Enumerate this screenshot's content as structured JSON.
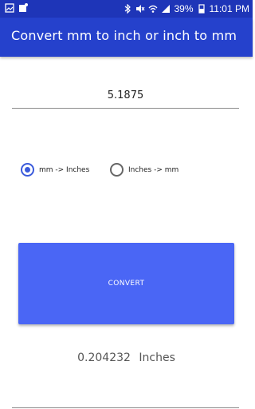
{
  "statusbar": {
    "battery": "39%",
    "time": "11:01 PM"
  },
  "appbar": {
    "title": "Convert mm to inch or inch to mm"
  },
  "input": {
    "value": "5.1875"
  },
  "options": [
    {
      "label": "mm -> Inches",
      "checked": true
    },
    {
      "label": "Inches -> mm",
      "checked": false
    }
  ],
  "convert": {
    "label": "CONVERT"
  },
  "result": {
    "value": "0.204232",
    "unit": "Inches"
  },
  "colors": {
    "statusbar": "#1e35b8",
    "appbar": "#2541cc",
    "button": "#4a66f5",
    "radio_accent": "#3b5bdb"
  }
}
